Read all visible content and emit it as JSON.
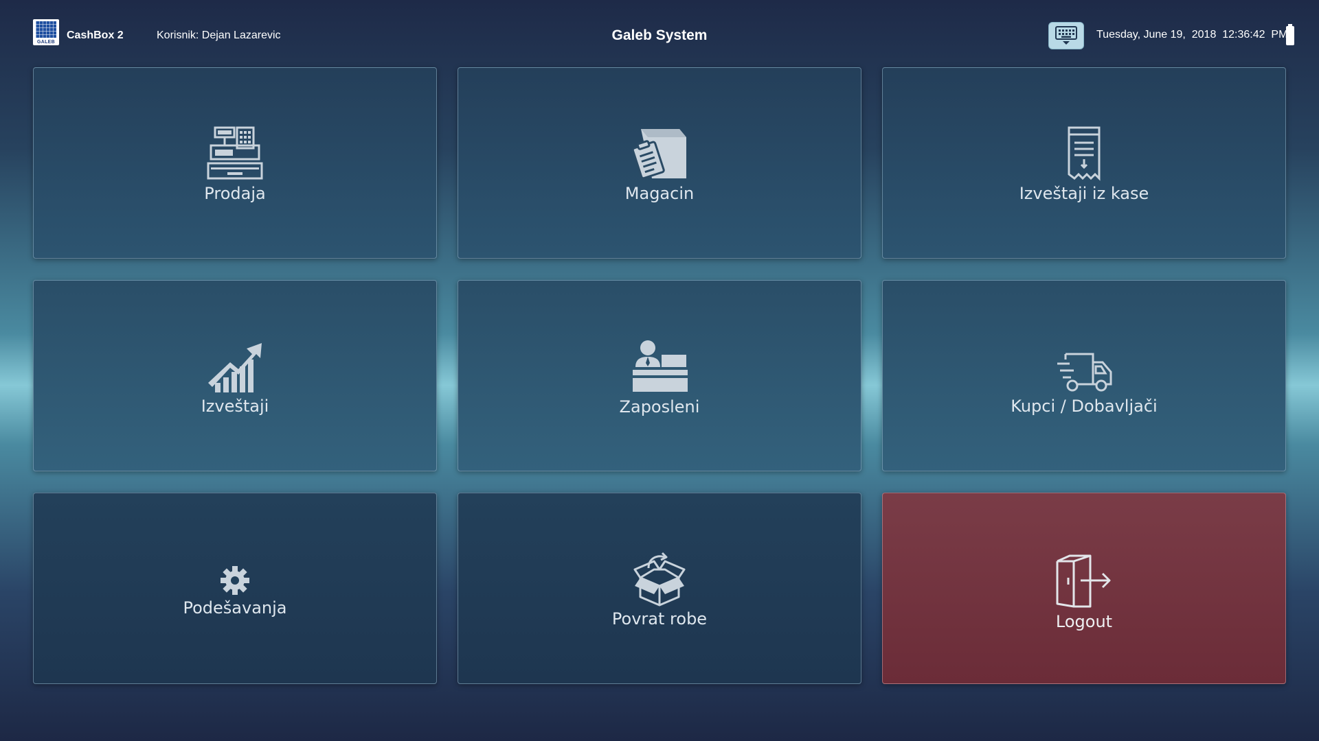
{
  "header": {
    "logo_text": "GALEB",
    "app_name": "CashBox 2",
    "user_label": "Korisnik: Dejan Lazarevic",
    "title": "Galeb System",
    "datetime": "Tuesday, June 19,  2018  12:36:42  PM",
    "keyboard_icon": "keyboard-icon",
    "battery_icon": "battery-icon"
  },
  "tiles": [
    {
      "label": "Prodaja",
      "icon": "cash-register-icon"
    },
    {
      "label": "Magacin",
      "icon": "warehouse-box-icon"
    },
    {
      "label": "Izveštaji iz kase",
      "icon": "receipt-icon"
    },
    {
      "label": "Izveštaji",
      "icon": "chart-growth-icon"
    },
    {
      "label": "Zaposleni",
      "icon": "employee-desk-icon"
    },
    {
      "label": "Kupci / Dobavljači",
      "icon": "delivery-truck-icon"
    },
    {
      "label": "Podešavanja",
      "icon": "gear-icon"
    },
    {
      "label": "Povrat robe",
      "icon": "return-box-icon"
    },
    {
      "label": "Logout",
      "icon": "logout-door-icon"
    }
  ],
  "colors": {
    "tile": "#264660",
    "logout_tile": "#743441",
    "icon": "#c9d3dc"
  }
}
